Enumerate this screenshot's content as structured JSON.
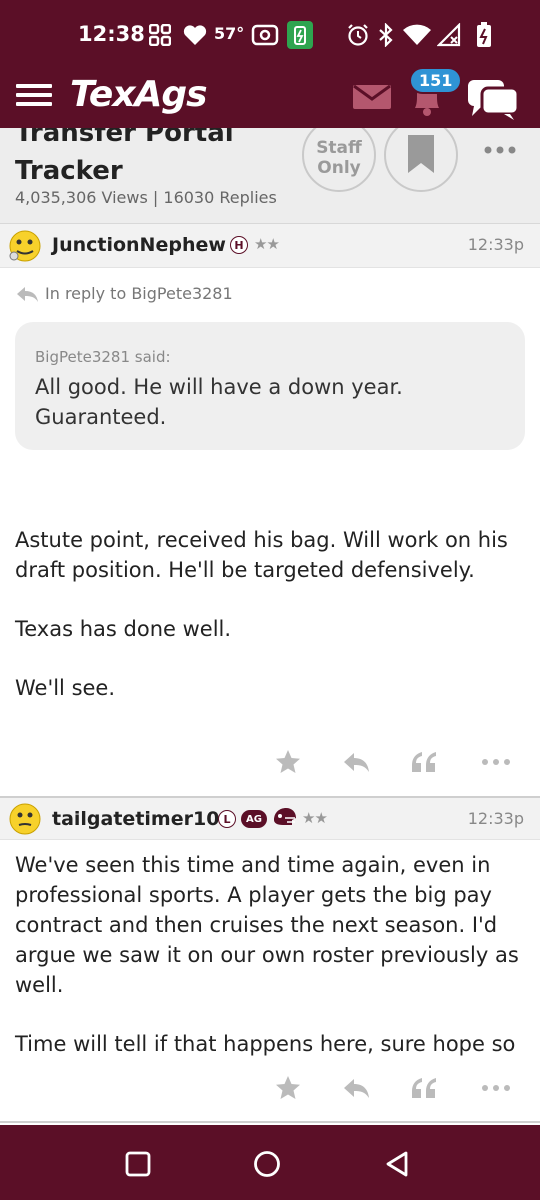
{
  "status_bar": {
    "time": "12:38",
    "temperature": "57°",
    "icons": [
      "grid-icon",
      "heart-icon",
      "radio-icon",
      "battery-saver-icon",
      "alarm-icon",
      "bluetooth-icon",
      "wifi-icon",
      "signal-icon",
      "battery-icon"
    ]
  },
  "app_bar": {
    "logo": "TexAgs",
    "notification_count": "151"
  },
  "thread": {
    "title": "Transfer Portal Tracker",
    "stats": "4,035,306 Views | 16030 Replies",
    "staff_only_label_line1": "Staff",
    "staff_only_label_line2": "Only"
  },
  "posts": [
    {
      "username": "JunctionNephew",
      "badge": "H",
      "stars": "★★",
      "time": "12:33p",
      "reply_to": "In reply to BigPete3281",
      "quote_author": "BigPete3281 said:",
      "quote_text": "All good. He will have a down year. Guaranteed.",
      "paragraphs": [
        "Astute point, received his bag. Will work on his draft position. He'll be targeted defensively.",
        "Texas has done well.",
        "We'll see."
      ]
    },
    {
      "username": "tailgatetimer10",
      "badge": "L",
      "badge2": "AG",
      "stars": "★★",
      "time": "12:33p",
      "paragraphs": [
        "We've seen this time and time again, even in professional sports. A player gets the big pay contract and then cruises the next season. I'd argue we saw it on our own roster previously as well.",
        "Time will tell if that happens here, sure hope so"
      ]
    }
  ],
  "colors": {
    "maroon": "#5b0f27",
    "badge_blue": "#2f93d5",
    "header_gray": "#ededed"
  }
}
